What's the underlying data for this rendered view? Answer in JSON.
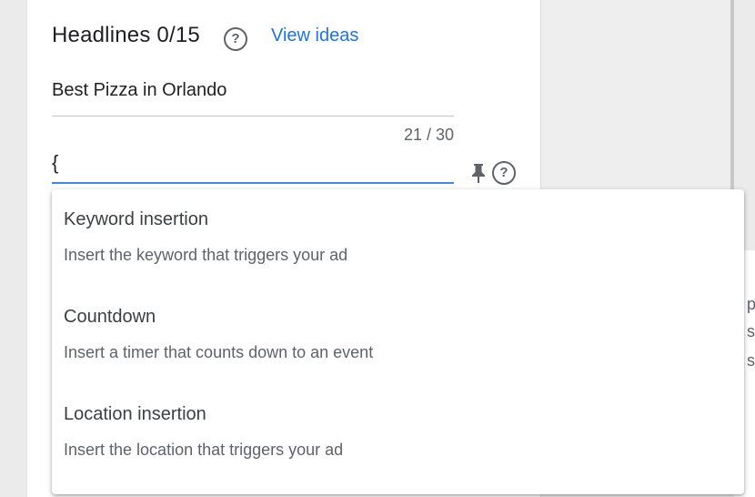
{
  "headlines": {
    "title": "Headlines 0/15",
    "view_ideas": "View ideas",
    "first_value": "Best Pizza in Orlando",
    "char_counter": "21 / 30",
    "active_value": "{"
  },
  "dropdown": {
    "options": [
      {
        "title": "Keyword insertion",
        "description": "Insert the keyword that triggers your ad"
      },
      {
        "title": "Countdown",
        "description": "Insert a timer that counts down to an event"
      },
      {
        "title": "Location insertion",
        "description": "Insert the location that triggers your ad"
      }
    ]
  },
  "icons": {
    "help": "help-circle-icon",
    "pin": "pin-icon"
  },
  "colors": {
    "link": "#1a73e8",
    "focus_underline": "#4285f4",
    "text_primary": "#202124",
    "text_secondary": "#5f6368"
  }
}
